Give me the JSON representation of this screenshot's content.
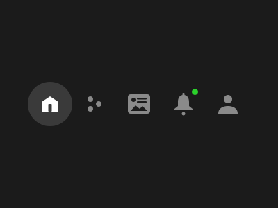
{
  "theme": {
    "background": "#1b1b1b",
    "active_pill": "#3a3a3a",
    "active_icon": "#ffffff",
    "inactive_icon": "#8a8a8a",
    "badge": "#2bd12b"
  },
  "nav": {
    "active": "home",
    "items": [
      {
        "id": "home",
        "icon": "home-icon",
        "active": true
      },
      {
        "id": "groups",
        "icon": "dots-cluster-icon",
        "active": false
      },
      {
        "id": "news",
        "icon": "news-card-icon",
        "active": false
      },
      {
        "id": "notifications",
        "icon": "bell-icon",
        "active": false,
        "has_badge": true
      },
      {
        "id": "profile",
        "icon": "person-icon",
        "active": false
      }
    ]
  }
}
